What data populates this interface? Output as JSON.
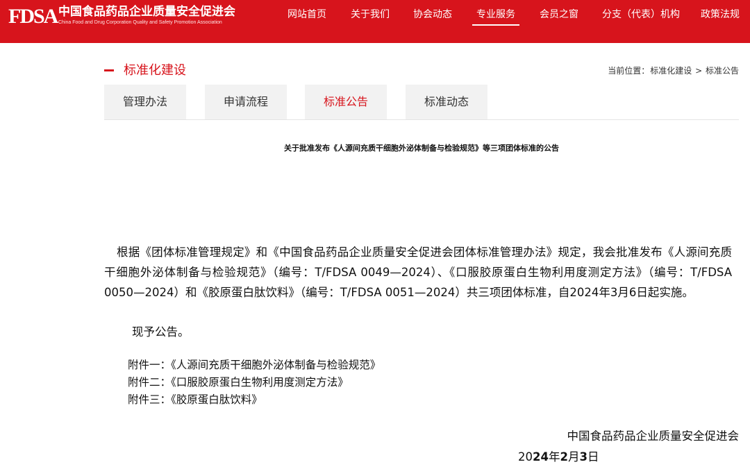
{
  "header": {
    "logo_mark": "FDSA",
    "org_name_cn": "中国食品药品企业质量安全促进会",
    "org_name_en": "China Food and Drug Corporation Quality and Safety Promotion Association",
    "nav": [
      {
        "label": "网站首页"
      },
      {
        "label": "关于我们"
      },
      {
        "label": "协会动态"
      },
      {
        "label": "专业服务",
        "active": true
      },
      {
        "label": "会员之窗"
      },
      {
        "label": "分支（代表）机构"
      },
      {
        "label": "政策法规"
      }
    ],
    "brand_color": "#d7141c"
  },
  "section": {
    "title": "标准化建设"
  },
  "breadcrumb": {
    "prefix": "当前位置：",
    "items": [
      "标准化建设",
      "标准公告"
    ],
    "separator": ">"
  },
  "tabs": [
    {
      "label": "管理办法"
    },
    {
      "label": "申请流程"
    },
    {
      "label": "标准公告",
      "active": true
    },
    {
      "label": "标准动态"
    }
  ],
  "article": {
    "title": "关于批准发布《人源间充质干细胞外泌体制备与检验规范》等三项团体标准的公告",
    "body": "根据《团体标准管理规定》和《中国食品药品企业质量安全促进会团体标准管理办法》规定，我会批准发布《人源间充质干细胞外泌体制备与检验规范》（编号：T/FDSA 0049—2024）、《口服胶原蛋白生物利用度测定方法》（编号：T/FDSA 0050—2024）和《胶原蛋白肽饮料》（编号：T/FDSA 0051—2024）共三项团体标准，自2024年3月6日起实施。",
    "notice": "现予公告。",
    "attachments": [
      "附件一：《人源间充质干细胞外泌体制备与检验规范》",
      "附件二：《口服胶原蛋白生物利用度测定方法》",
      "附件三：《胶原蛋白肽饮料》"
    ],
    "signature_org": "中国食品药品企业质量安全促进会",
    "signature_date": {
      "year_prefix": "20",
      "year_suffix": "24",
      "year_char": "年",
      "month": "2",
      "month_char": "月",
      "day": "3",
      "day_char": "日"
    }
  }
}
